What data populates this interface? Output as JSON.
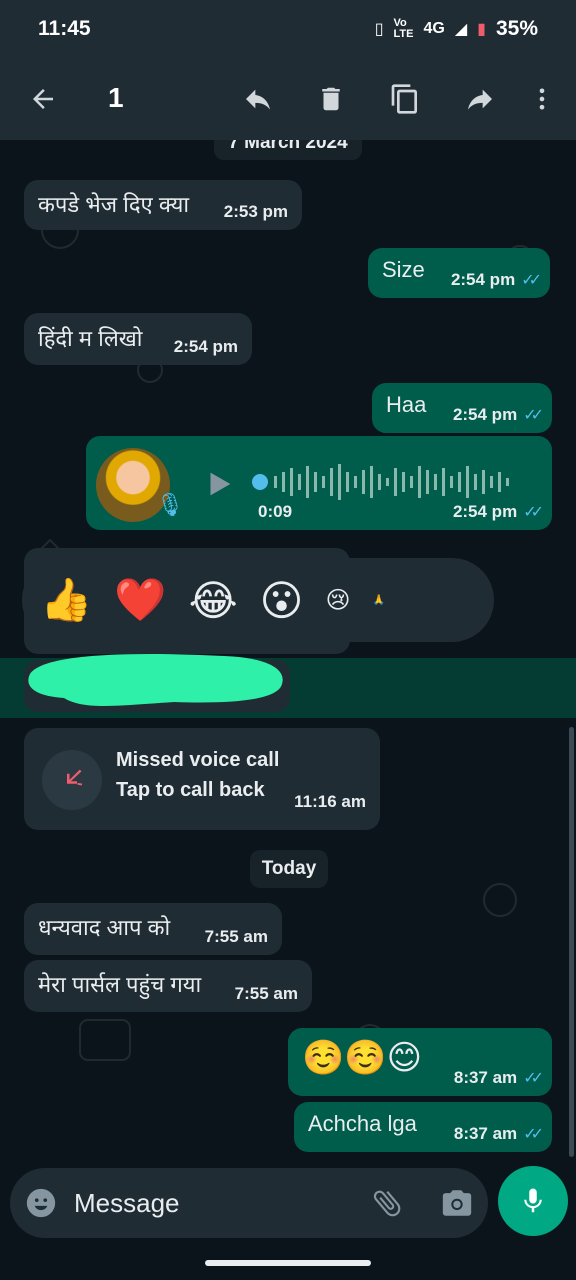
{
  "status": {
    "time": "11:45",
    "network": "4G",
    "volte": "Vo LTE",
    "battery": "35%"
  },
  "topbar": {
    "selected_count": "1",
    "icons": [
      "back-arrow-icon",
      "reply-icon",
      "delete-icon",
      "copy-icon",
      "forward-icon",
      "more-vertical-icon"
    ]
  },
  "chat": {
    "date_top": "7 March 2024",
    "messages": [
      {
        "text": "कपडे भेज दिए क्या",
        "time": "2:53 pm",
        "dir": "in"
      },
      {
        "text": "Size",
        "time": "2:54 pm",
        "dir": "out"
      },
      {
        "text": "हिंदी म लिखो",
        "time": "2:54 pm",
        "dir": "in"
      },
      {
        "text": "Haa",
        "time": "2:54 pm",
        "dir": "out"
      },
      {
        "text": "",
        "time": "2:54 pm",
        "dir": "out",
        "voice_duration": "0:09"
      }
    ],
    "reactions": [
      "👍",
      "❤️",
      "😂",
      "😮",
      "😢",
      "🙏"
    ],
    "missed_call": {
      "title": "Missed voice call",
      "subtitle": "Tap to call back",
      "time": "11:16 am"
    },
    "date_today": "Today",
    "today_messages": [
      {
        "text": "धन्यवाद आप को",
        "time": "7:55 am",
        "dir": "in"
      },
      {
        "text": "मेरा पार्सल पहुंच गया",
        "time": "7:55 am",
        "dir": "in"
      },
      {
        "text": "☺️☺️😊",
        "time": "8:37 am",
        "dir": "out"
      },
      {
        "text": "Achcha lga",
        "time": "8:37 am",
        "dir": "out"
      }
    ]
  },
  "input": {
    "placeholder": "Message"
  },
  "colors": {
    "outgoing": "#005c4b",
    "incoming": "#202c33",
    "accent": "#00a884",
    "ticks": "#53bdeb"
  }
}
